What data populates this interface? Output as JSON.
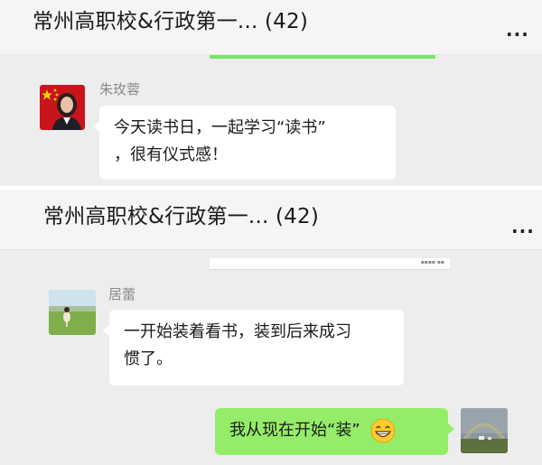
{
  "screenshot_top": {
    "header": {
      "title": "常州高职校&行政第一... (42)",
      "more_icon": "..."
    },
    "messages": [
      {
        "sender": "朱玫蓉",
        "avatar": "portrait-with-flag",
        "lines": [
          "今天读书日，一起学习“读书”",
          "，很有仪式感！"
        ]
      }
    ]
  },
  "screenshot_bottom": {
    "header": {
      "title": "常州高职校&行政第一... (42)",
      "more_icon": "..."
    },
    "messages": [
      {
        "sender": "居蕾",
        "avatar": "person-in-meadow",
        "lines": [
          "一开始装着看书，装到后来成习",
          "惯了。"
        ]
      },
      {
        "sender": "self",
        "avatar": "rainbow-landscape",
        "text": "我从现在开始“装”",
        "emoji": "grinning-face-icon"
      }
    ]
  },
  "colors": {
    "header_bg": "#f5f5f5",
    "chat_bg": "#ededed",
    "bubble_received": "#ffffff",
    "bubble_sent": "#95ec69",
    "sender_name": "#8a8a8a"
  }
}
